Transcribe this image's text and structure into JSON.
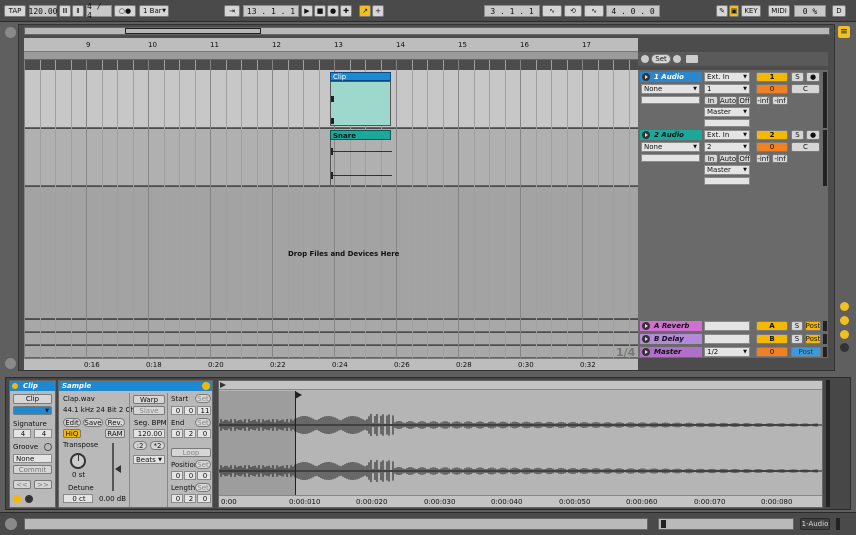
{
  "transport": {
    "tap": "TAP",
    "tempo": "120.00",
    "time_sig": "4 / 4",
    "quantize": "1 Bar",
    "position": "13 .   1 .   1",
    "loop_start": "3 .   1 .   1",
    "loop_length": "4 .   0 .   0",
    "key": "KEY",
    "midi": "MIDI",
    "cpu": "0 %",
    "disk": "D"
  },
  "ruler": {
    "bars": [
      "9",
      "10",
      "11",
      "12",
      "13",
      "14",
      "15",
      "16",
      "17"
    ],
    "times": [
      "0:16",
      "0:18",
      "0:20",
      "0:22",
      "0:24",
      "0:26",
      "0:28",
      "0:30",
      "0:32"
    ]
  },
  "set_label": "Set",
  "arrangement": {
    "drop_text": "Drop Files and Devices Here",
    "zoom": "1/4",
    "clips": [
      {
        "name": "Clip",
        "color": "#1e88d0"
      },
      {
        "name": "Snare",
        "color": "#1aa89a"
      }
    ]
  },
  "tracks": [
    {
      "name": "1 Audio",
      "color": "#2a86cf",
      "input_type": "Ext. In",
      "input_channel": "1",
      "output": "Master",
      "monitor": [
        "In",
        "Auto",
        "Off"
      ],
      "number": "1",
      "volume": "0",
      "pan": "C",
      "sends": [
        "-inf",
        "-inf"
      ],
      "solo": "S",
      "routing_left": "None"
    },
    {
      "name": "2 Audio",
      "color": "#1aa89a",
      "input_type": "Ext. In",
      "input_channel": "2",
      "output": "Master",
      "monitor": [
        "In",
        "Auto",
        "Off"
      ],
      "number": "2",
      "volume": "0",
      "pan": "C",
      "sends": [
        "-inf",
        "-inf"
      ],
      "solo": "S",
      "routing_left": "None"
    }
  ],
  "returns": [
    {
      "name": "A Reverb",
      "color": "#d070d0",
      "letter": "A",
      "solo": "S",
      "post": "Post"
    },
    {
      "name": "B Delay",
      "color": "#b48ad8",
      "letter": "B",
      "solo": "S",
      "post": "Post"
    }
  ],
  "master": {
    "name": "Master",
    "color": "#b070c8",
    "cue": "1/2",
    "volume": "0",
    "post": "Post"
  },
  "clip_view": {
    "title": "Clip",
    "name": "Clip",
    "signature_label": "Signature",
    "sig_num": "4",
    "sig_den": "4",
    "groove_label": "Groove",
    "groove": "None",
    "commit": "Commit",
    "nav_left": "<<",
    "nav_right": ">>"
  },
  "sample_view": {
    "title": "Sample",
    "file": "Clap.wav",
    "info": "44.1 kHz 24 Bit 2 Ch",
    "edit": "Edit",
    "save": "Save",
    "rev": "Rev.",
    "hiq": "HiQ",
    "ram": "RAM",
    "transpose_label": "Transpose",
    "transpose": "0 st",
    "detune_label": "Detune",
    "detune": "0 ct",
    "gain": "0.00 dB",
    "warp": "Warp",
    "slave": "Slave",
    "seg_bpm_label": "Seg. BPM",
    "seg_bpm": "120.00",
    "half": ":2",
    "double": "*2",
    "warp_mode": "Beats",
    "start_label": "Start",
    "start": [
      "0",
      "0",
      "11"
    ],
    "end_label": "End",
    "end": [
      "0",
      "2",
      "0"
    ],
    "set": "Set",
    "loop": "Loop",
    "position_label": "Position",
    "position": [
      "0",
      "0",
      "0"
    ],
    "length_label": "Length",
    "length": [
      "0",
      "2",
      "0"
    ]
  },
  "waveform": {
    "time_ticks": [
      "0:00",
      "0:00:010",
      "0:00:020",
      "0:00:030",
      "0:00:040",
      "0:00:050",
      "0:00:060",
      "0:00:070",
      "0:00:080"
    ]
  },
  "status": {
    "track": "1-Audio"
  }
}
